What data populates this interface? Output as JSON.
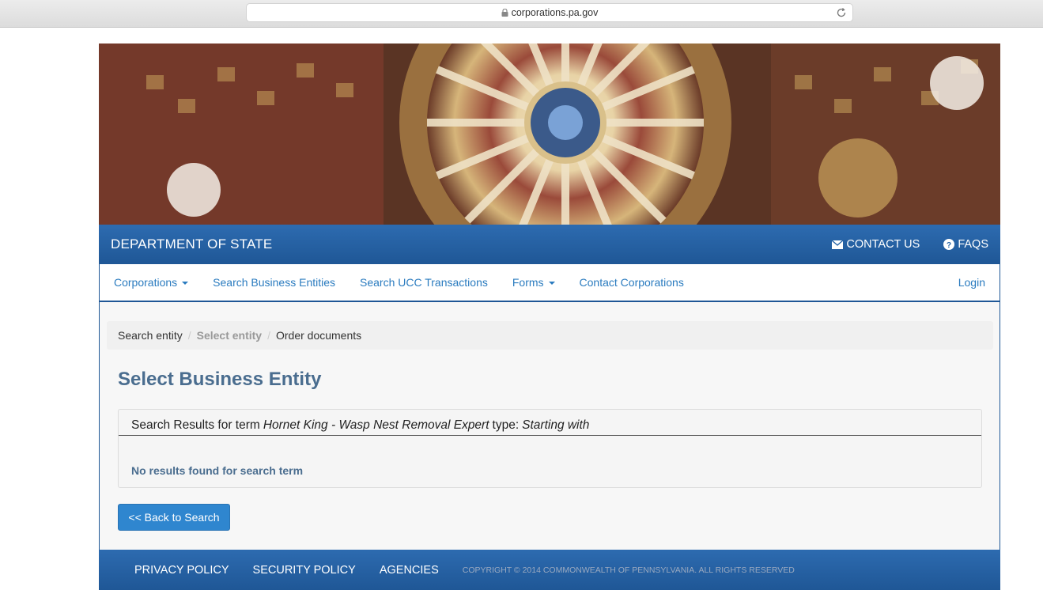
{
  "browser": {
    "url": "corporations.pa.gov"
  },
  "topbar": {
    "title": "DEPARTMENT OF STATE",
    "contact_label": "CONTACT US",
    "faqs_label": "FAQS"
  },
  "nav": {
    "items": [
      {
        "label": "Corporations"
      },
      {
        "label": "Search Business Entities"
      },
      {
        "label": "Search UCC Transactions"
      },
      {
        "label": "Forms"
      },
      {
        "label": "Contact Corporations"
      }
    ],
    "login_label": "Login"
  },
  "breadcrumb": {
    "items": [
      "Search entity",
      "Select entity",
      "Order documents"
    ]
  },
  "main": {
    "heading": "Select Business Entity",
    "results_prefix": "Search Results for term",
    "search_term": "Hornet King - Wasp Nest Removal Expert",
    "type_label": "type:",
    "type_value": "Starting with",
    "no_results": "No results found for search term",
    "back_label": "<< Back to Search"
  },
  "footer": {
    "privacy": "PRIVACY POLICY",
    "security": "SECURITY POLICY",
    "agencies": "AGENCIES",
    "copyright": "COPYRIGHT © 2014 COMMONWEALTH OF PENNSYLVANIA. ALL RIGHTS RESERVED"
  },
  "colors": {
    "brand_blue": "#1f5796",
    "link_blue": "#2a7bbf",
    "heading": "#4a6d8f",
    "button": "#2f86cf"
  }
}
